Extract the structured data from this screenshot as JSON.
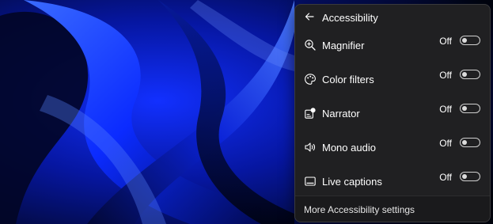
{
  "desktop": {
    "wallpaper_colors": [
      "#0a1cff",
      "#0010a8",
      "#000520",
      "#2a55ff"
    ]
  },
  "quick_settings": {
    "header": {
      "back_icon": "arrow-left-icon",
      "title": "Accessibility"
    },
    "items": [
      {
        "label": "Magnifier",
        "icon": "magnifier-zoom-icon",
        "state": "Off",
        "on": false
      },
      {
        "label": "Color filters",
        "icon": "color-filters-icon",
        "state": "Off",
        "on": false
      },
      {
        "label": "Narrator",
        "icon": "narrator-icon",
        "state": "Off",
        "on": false
      },
      {
        "label": "Mono audio",
        "icon": "mono-audio-icon",
        "state": "Off",
        "on": false
      },
      {
        "label": "Live captions",
        "icon": "live-captions-icon",
        "state": "Off",
        "on": false
      }
    ],
    "footer": {
      "link_label": "More Accessibility settings"
    },
    "colors": {
      "panel_bg": "#202022",
      "text": "#ffffff",
      "toggle_outline": "#cfcfcf"
    }
  }
}
